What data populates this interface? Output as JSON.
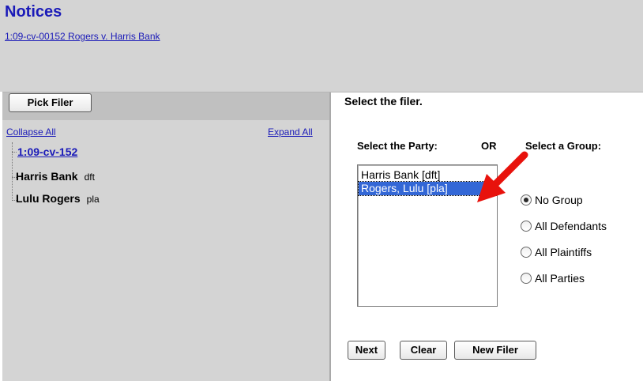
{
  "header": {
    "title": "Notices",
    "case_link": "1:09-cv-00152 Rogers v. Harris Bank"
  },
  "left": {
    "pick_filer_label": "Pick Filer",
    "collapse_all": "Collapse All",
    "expand_all": "Expand All",
    "tree": {
      "case_number": "1:09-cv-152",
      "parties": [
        {
          "name": "Harris Bank",
          "role": "dft"
        },
        {
          "name": "Lulu Rogers",
          "role": "pla"
        }
      ]
    }
  },
  "right": {
    "heading": "Select the filer.",
    "party_label": "Select the Party:",
    "or_label": "OR",
    "group_label": "Select a Group:",
    "party_options": [
      {
        "text": "Harris Bank  [dft]",
        "selected": false
      },
      {
        "text": "Rogers, Lulu  [pla]",
        "selected": true
      }
    ],
    "groups": [
      {
        "label": "No Group",
        "checked": true
      },
      {
        "label": "All Defendants",
        "checked": false
      },
      {
        "label": "All Plaintiffs",
        "checked": false
      },
      {
        "label": "All Parties",
        "checked": false
      }
    ],
    "buttons": {
      "next": "Next",
      "clear": "Clear",
      "new_filer": "New Filer"
    }
  },
  "colors": {
    "header_bg": "#d4d4d4",
    "link": "#1a1ab8",
    "selection": "#3367d6",
    "annotation_arrow": "#e8120c"
  },
  "icons": {
    "annotation": "red-arrow-icon"
  }
}
